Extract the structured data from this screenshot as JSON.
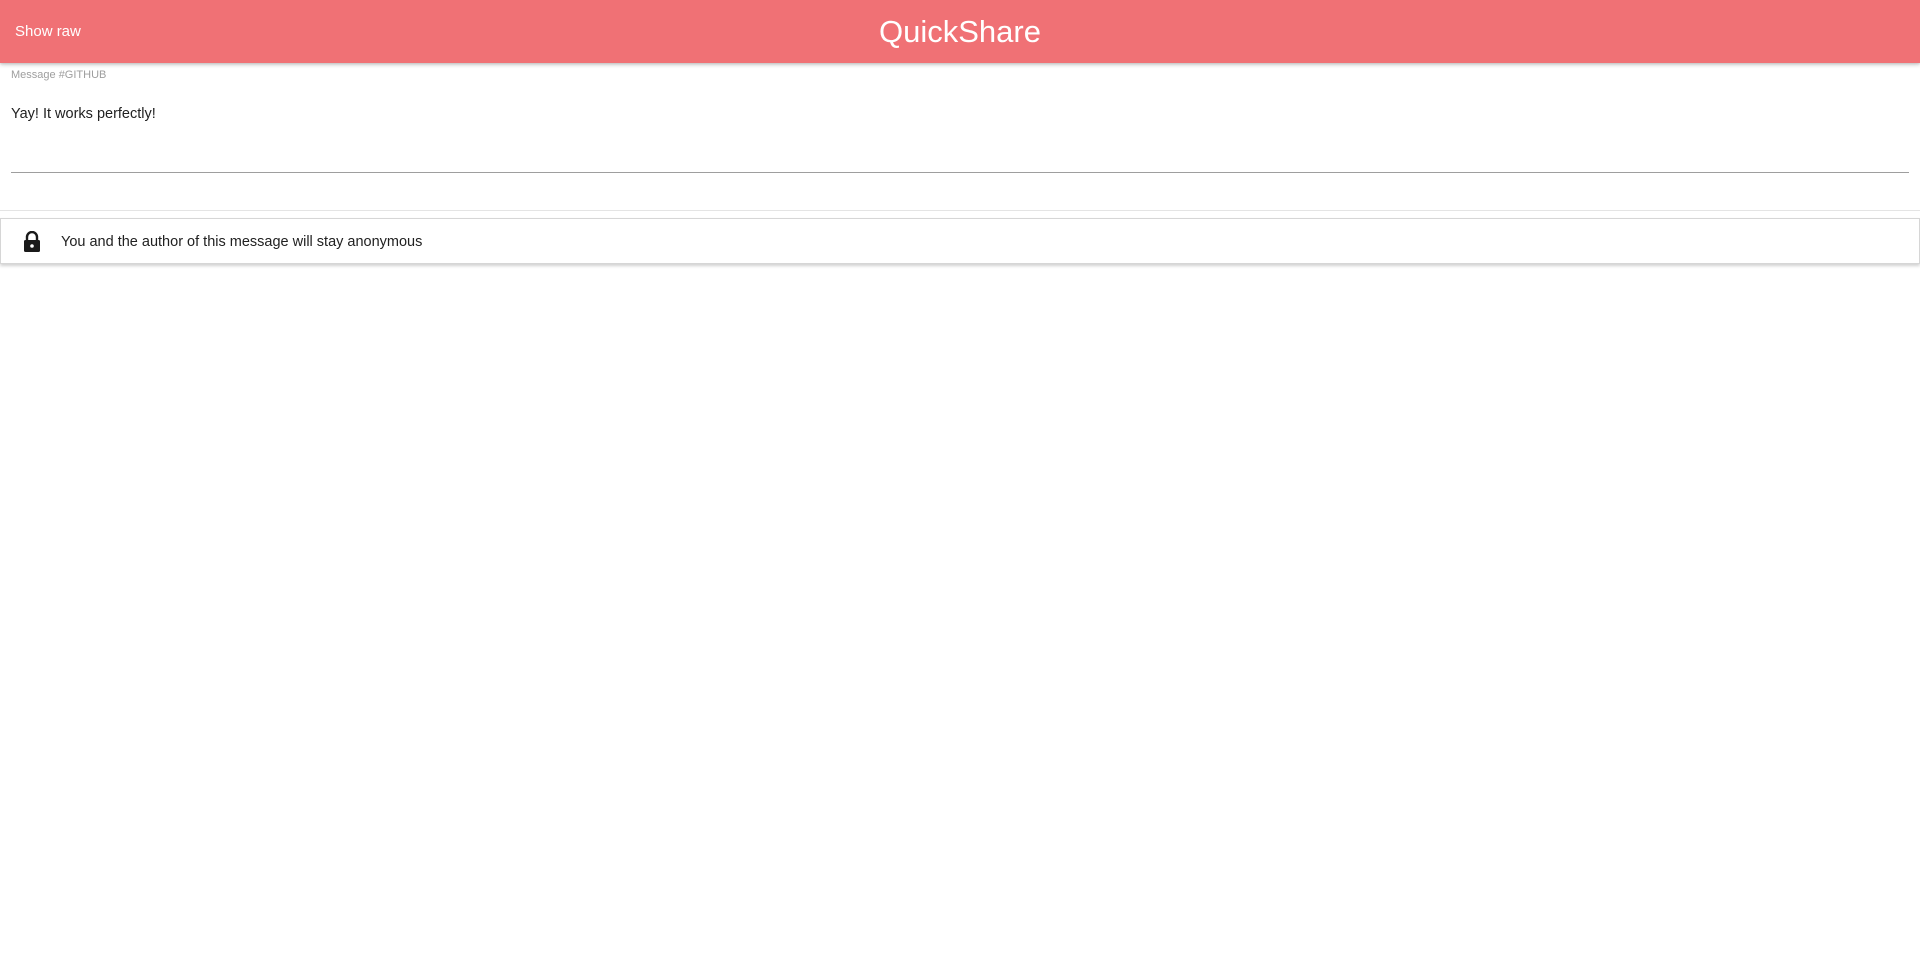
{
  "header": {
    "show_raw_label": "Show raw",
    "title": "QuickShare",
    "background_color": "#f07175"
  },
  "message": {
    "label": "Message #GITHUB",
    "text": "Yay! It works perfectly!"
  },
  "notice": {
    "icon": "lock-icon",
    "text": "You and the author of this message will stay anonymous"
  }
}
